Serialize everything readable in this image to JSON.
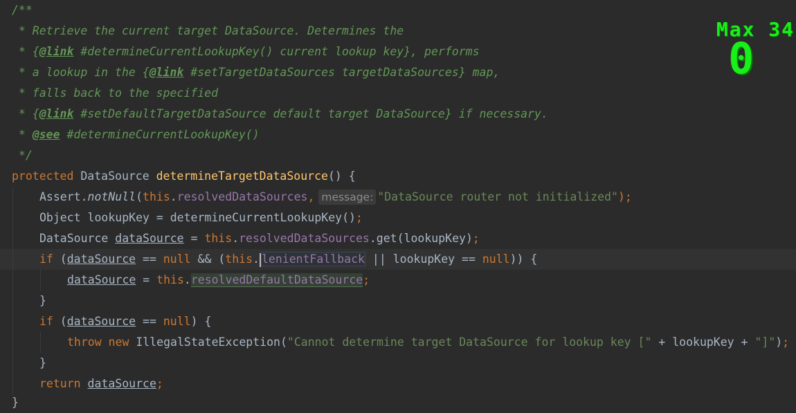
{
  "editor": {
    "javadoc": {
      "open": "/**",
      "line1": " * Retrieve the current target DataSource. Determines the",
      "line2_prefix": " * {",
      "line2_tag": "@link",
      "line2_rest": " #determineCurrentLookupKey() current lookup key}, performs",
      "line3_prefix": " * a lookup in the {",
      "line3_tag": "@link",
      "line3_rest": " #setTargetDataSources targetDataSources} map,",
      "line4": " * falls back to the specified",
      "line5_prefix": " * {",
      "line5_tag": "@link",
      "line5_rest": " #setDefaultTargetDataSource default target DataSource} if necessary.",
      "line6_prefix": " * ",
      "line6_tag": "@see",
      "line6_rest": " #determineCurrentLookupKey()",
      "close": " */"
    },
    "method": {
      "modifier": "protected",
      "return_type": " DataSource ",
      "name": "determineTargetDataSource",
      "signature_end": "() {"
    },
    "assert_line": {
      "cls": "Assert.",
      "method": "notNull",
      "open": "(",
      "this_kw": "this",
      "dot": ".",
      "field": "resolvedDataSources",
      "comma": ",",
      "hint": "message:",
      "str": "\"DataSource router not initialized\"",
      "close": ");"
    },
    "lookup_line": {
      "text": "Object lookupKey = determineCurrentLookupKey()",
      "semi": ";"
    },
    "ds_line": {
      "type": "DataSource ",
      "var": "dataSource",
      "eq": " = ",
      "this_kw": "this",
      "dot": ".",
      "field": "resolvedDataSources",
      "rest": ".get(lookupKey)",
      "semi": ";"
    },
    "if1_line": {
      "kw": "if",
      "open": " (",
      "var": "dataSource",
      "op1": " == ",
      "null_kw": "null",
      "op2": " && (",
      "this_kw": "this",
      "dot": ".",
      "field": "lenientFallback",
      "op3": " || lookupKey == ",
      "null_kw2": "null",
      "close": ")) {"
    },
    "assign_line": {
      "var": "dataSource",
      "eq": " = ",
      "this_kw": "this",
      "dot": ".",
      "field": "resolvedDefaultDataSource",
      "semi": ";"
    },
    "brace1": "}",
    "if2_line": {
      "kw": "if",
      "open": " (",
      "var": "dataSource",
      "op": " == ",
      "null_kw": "null",
      "close": ") {"
    },
    "throw_line": {
      "throw_kw": "throw",
      "new_kw": " new",
      "cls": " IllegalStateException(",
      "str1": "\"Cannot determine target DataSource for lookup key [\"",
      "mid": " + lookupKey + ",
      "str2": "\"]\"",
      "close": ")",
      "semi": ";"
    },
    "brace2": "}",
    "return_line": {
      "kw": "return",
      "space": " ",
      "var": "dataSource",
      "semi": ";"
    },
    "brace3": "}"
  },
  "overlay": {
    "max_label": "Max 34",
    "combo_count": "0"
  },
  "colors": {
    "background": "#2b2b2b",
    "comment": "#629755",
    "keyword": "#cc7832",
    "method": "#ffc66d",
    "field": "#9876aa",
    "string": "#6a8759",
    "text": "#a9b7c6",
    "overlay": "#19f019"
  }
}
